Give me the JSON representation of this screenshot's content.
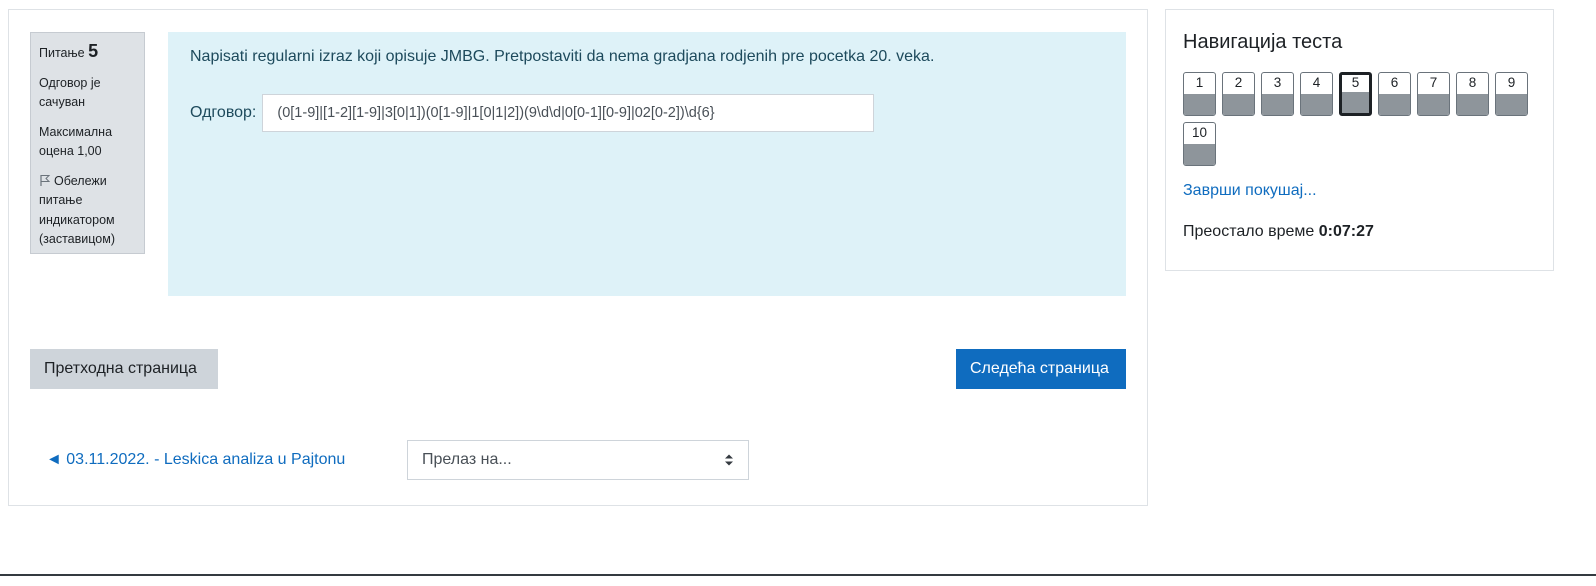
{
  "info": {
    "question_label": "Питање",
    "question_number": "5",
    "status": "Одговор је сачуван",
    "max_grade": "Максимална оцена 1,00",
    "flag_text": "Обележи питање индикатором (заставицом)"
  },
  "question": {
    "text": "Napisati regularni izraz koji opisuje JMBG. Pretpostaviti da nema gradjana rodjenih pre pocetka 20. veka.",
    "answer_label": "Одговор:",
    "answer_value": "(0[1-9]|[1-2][1-9]|3[0|1])(0[1-9]|1[0|1|2])(9\\d\\d|0[0-1][0-9]|02[0-2])\\d{6}"
  },
  "buttons": {
    "prev_page": "Претходна страница",
    "next_page": "Следећа страница"
  },
  "prev_activity_link": "◄ 03.11.2022. - Leskica analiza u Pajtonu",
  "jump_select": "Прелаз на...",
  "quiz_nav": {
    "title": "Навигација теста",
    "questions": [
      "1",
      "2",
      "3",
      "4",
      "5",
      "6",
      "7",
      "8",
      "9",
      "10"
    ],
    "current_question": "5",
    "finish_link": "Заврши покушај...",
    "time_label": "Преостало време",
    "time_value": "0:07:27"
  }
}
